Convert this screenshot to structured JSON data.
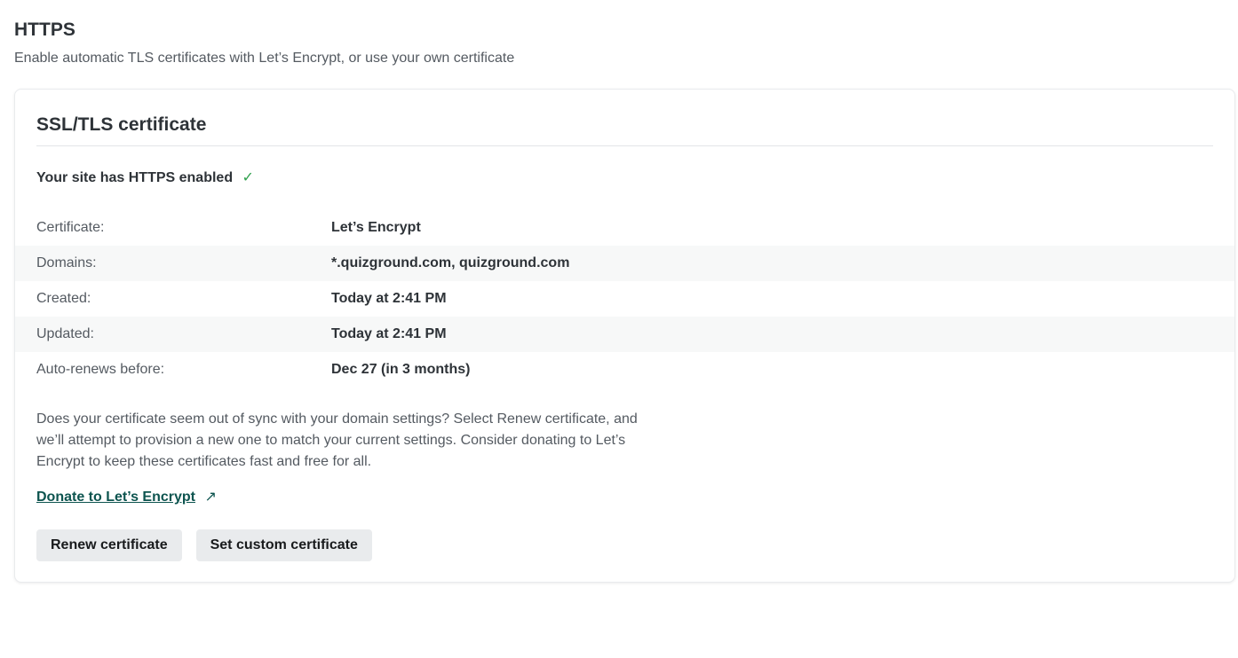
{
  "section": {
    "title": "HTTPS",
    "subtitle": "Enable automatic TLS certificates with Let’s Encrypt, or use your own certificate"
  },
  "card": {
    "title": "SSL/TLS certificate",
    "status_text": "Your site has HTTPS enabled",
    "status_icon": "check-icon",
    "status_icon_glyph": "✓",
    "status_color": "#30a14e",
    "details": [
      {
        "label": "Certificate:",
        "value": "Let’s Encrypt"
      },
      {
        "label": "Domains:",
        "value": "*.quizground.com, quizground.com"
      },
      {
        "label": "Created:",
        "value": "Today at 2:41 PM"
      },
      {
        "label": "Updated:",
        "value": "Today at 2:41 PM"
      },
      {
        "label": "Auto-renews before:",
        "value": "Dec 27 (in 3 months)"
      }
    ],
    "explanation": "Does your certificate seem out of sync with your domain settings? Select Renew certificate, and we’ll attempt to provision a new one to match your current settings. Consider donating to Let’s Encrypt to keep these certificates fast and free for all.",
    "donate_link": "Donate to Let’s Encrypt",
    "donate_icon": "external-link-icon",
    "donate_icon_glyph": "↗",
    "link_color": "#0d544f",
    "buttons": {
      "renew": "Renew certificate",
      "custom": "Set custom certificate"
    }
  }
}
